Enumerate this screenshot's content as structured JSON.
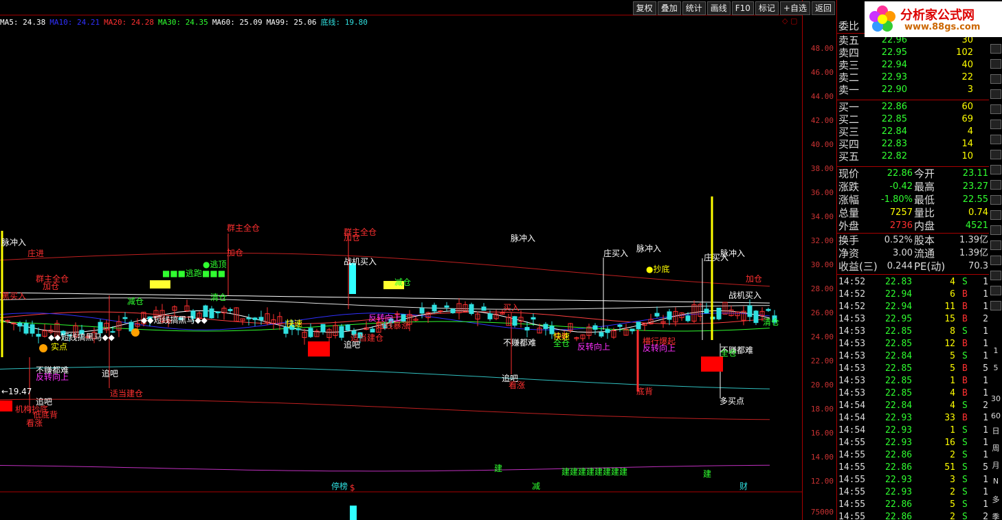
{
  "ma_legend": [
    {
      "text": "MA5: 24.38",
      "color": "#ffffff"
    },
    {
      "text": "MA10: 24.21",
      "color": "#3030ff"
    },
    {
      "text": "MA20: 24.28",
      "color": "#ff3030"
    },
    {
      "text": "MA30: 24.35",
      "color": "#30ff30"
    },
    {
      "text": "MA60: 25.09",
      "color": "#ffffff"
    },
    {
      "text": "MA99: 25.06",
      "color": "#ffffff"
    },
    {
      "text": "底线: 19.80",
      "color": "#30e0e0"
    }
  ],
  "toolbar": [
    "复权",
    "叠加",
    "统计",
    "画线",
    "F10",
    "标记",
    "+自选",
    "返回"
  ],
  "price_ticks": [
    "48.00",
    "46.00",
    "44.00",
    "42.00",
    "40.00",
    "38.00",
    "36.00",
    "34.00",
    "32.00",
    "30.00",
    "28.00",
    "26.00",
    "24.00",
    "22.00",
    "20.00",
    "18.00",
    "16.00",
    "14.00",
    "12.00"
  ],
  "volume_tick": "75000",
  "low_marker": "←19.47",
  "logo": {
    "title": "分析家公式网",
    "url": "www.88gs.com"
  },
  "order_book": {
    "header": "委比",
    "sells": [
      {
        "label": "卖五",
        "price": "22.96",
        "vol": "30"
      },
      {
        "label": "卖四",
        "price": "22.95",
        "vol": "102"
      },
      {
        "label": "卖三",
        "price": "22.94",
        "vol": "40"
      },
      {
        "label": "卖二",
        "price": "22.93",
        "vol": "22"
      },
      {
        "label": "卖一",
        "price": "22.90",
        "vol": "3"
      }
    ],
    "buys": [
      {
        "label": "买一",
        "price": "22.86",
        "vol": "60"
      },
      {
        "label": "买二",
        "price": "22.85",
        "vol": "69"
      },
      {
        "label": "买三",
        "price": "22.84",
        "vol": "4"
      },
      {
        "label": "买四",
        "price": "22.83",
        "vol": "14"
      },
      {
        "label": "买五",
        "price": "22.82",
        "vol": "10"
      }
    ]
  },
  "quote": [
    {
      "l1": "现价",
      "v1": "22.86",
      "l2": "今开",
      "v2": "23.11",
      "c1": "#30ff30",
      "c2": "#30ff30"
    },
    {
      "l1": "涨跌",
      "v1": "-0.42",
      "l2": "最高",
      "v2": "23.27",
      "c1": "#30ff30",
      "c2": "#30ff30"
    },
    {
      "l1": "涨幅",
      "v1": "-1.80%",
      "l2": "最低",
      "v2": "22.55",
      "c1": "#30ff30",
      "c2": "#30ff30"
    },
    {
      "l1": "总量",
      "v1": "7257",
      "l2": "量比",
      "v2": "0.74",
      "c1": "#ffff00",
      "c2": "#ffff00"
    },
    {
      "l1": "外盘",
      "v1": "2736",
      "l2": "内盘",
      "v2": "4521",
      "c1": "#ff3030",
      "c2": "#30ff30"
    }
  ],
  "fundamentals": [
    {
      "l1": "换手",
      "v1": "0.52%",
      "l2": "股本",
      "v2": "1.39亿"
    },
    {
      "l1": "净资",
      "v1": "3.00",
      "l2": "流通",
      "v2": "1.39亿"
    },
    {
      "l1": "收益(三)",
      "v1": "0.244",
      "l2": "PE(动)",
      "v2": "70.3"
    }
  ],
  "ticks": [
    {
      "t": "14:52",
      "p": "22.83",
      "v": "4",
      "s": "S",
      "n": "1"
    },
    {
      "t": "14:52",
      "p": "22.94",
      "v": "6",
      "s": "B",
      "n": "1"
    },
    {
      "t": "14:52",
      "p": "22.94",
      "v": "11",
      "s": "B",
      "n": "1"
    },
    {
      "t": "14:53",
      "p": "22.95",
      "v": "15",
      "s": "B",
      "n": "2"
    },
    {
      "t": "14:53",
      "p": "22.85",
      "v": "8",
      "s": "S",
      "n": "1"
    },
    {
      "t": "14:53",
      "p": "22.85",
      "v": "12",
      "s": "B",
      "n": "1"
    },
    {
      "t": "14:53",
      "p": "22.84",
      "v": "5",
      "s": "S",
      "n": "1"
    },
    {
      "t": "14:53",
      "p": "22.85",
      "v": "5",
      "s": "B",
      "n": "5"
    },
    {
      "t": "14:53",
      "p": "22.85",
      "v": "1",
      "s": "B",
      "n": "1"
    },
    {
      "t": "14:53",
      "p": "22.85",
      "v": "4",
      "s": "B",
      "n": "1"
    },
    {
      "t": "14:54",
      "p": "22.84",
      "v": "4",
      "s": "S",
      "n": "2"
    },
    {
      "t": "14:54",
      "p": "22.93",
      "v": "33",
      "s": "B",
      "n": "1"
    },
    {
      "t": "14:54",
      "p": "22.93",
      "v": "1",
      "s": "S",
      "n": "1"
    },
    {
      "t": "14:55",
      "p": "22.93",
      "v": "16",
      "s": "S",
      "n": "1"
    },
    {
      "t": "14:55",
      "p": "22.86",
      "v": "2",
      "s": "S",
      "n": "1"
    },
    {
      "t": "14:55",
      "p": "22.86",
      "v": "51",
      "s": "S",
      "n": "5"
    },
    {
      "t": "14:55",
      "p": "22.93",
      "v": "3",
      "s": "S",
      "n": "1"
    },
    {
      "t": "14:55",
      "p": "22.93",
      "v": "2",
      "s": "S",
      "n": "1"
    },
    {
      "t": "14:55",
      "p": "22.86",
      "v": "5",
      "s": "S",
      "n": "1"
    },
    {
      "t": "14:55",
      "p": "22.86",
      "v": "2",
      "s": "S",
      "n": "2"
    }
  ],
  "side_items": [
    "1",
    "5",
    "30",
    "60",
    "日",
    "周",
    "月",
    "N",
    "多",
    "季"
  ],
  "chart_labels": [
    {
      "text": "脉冲入",
      "color": "#ffffff"
    },
    {
      "text": "庄进",
      "color": "#ff3030"
    },
    {
      "text": "群主全仓",
      "color": "#ff3030"
    },
    {
      "text": "加仓",
      "color": "#ff3030"
    },
    {
      "text": "黑买入",
      "color": "#ff3030"
    },
    {
      "text": "群主全仓",
      "color": "#ff3030"
    },
    {
      "text": "加仓",
      "color": "#ff3030"
    },
    {
      "text": "群主全仓",
      "color": "#ff3030"
    },
    {
      "text": "加仓",
      "color": "#ff3030"
    },
    {
      "text": "脉冲入",
      "color": "#ffffff"
    },
    {
      "text": "庄买入",
      "color": "#ffffff"
    },
    {
      "text": "脉冲入",
      "color": "#ffffff"
    },
    {
      "text": "庄买入",
      "color": "#ffffff"
    },
    {
      "text": "脉冲入",
      "color": "#ffffff"
    },
    {
      "text": "战机买入",
      "color": "#ffffff"
    },
    {
      "text": "●逃顶",
      "color": "#30ff30"
    },
    {
      "text": "■■■逃跑■■■",
      "color": "#30ff30"
    },
    {
      "text": "减仓",
      "color": "#30ff30"
    },
    {
      "text": "清仓",
      "color": "#30ff30"
    },
    {
      "text": "减仓",
      "color": "#30ff30"
    },
    {
      "text": "●抄底",
      "color": "#ffff00"
    },
    {
      "text": "加仓",
      "color": "#ff3030"
    },
    {
      "text": "战机买入",
      "color": "#ffffff"
    },
    {
      "text": "清仓",
      "color": "#30ff30"
    },
    {
      "text": "◆◆短线搞黑马◆◆",
      "color": "#ffffff"
    },
    {
      "text": "◆◆短线搞黑马◆◆",
      "color": "#ffffff"
    },
    {
      "text": "快速",
      "color": "#ffff00"
    },
    {
      "text": "反转向上",
      "color": "#ff30ff"
    },
    {
      "text": "短线暴涨",
      "color": "#ff3030"
    },
    {
      "text": "追吧",
      "color": "#ffffff"
    },
    {
      "text": "适当建仓",
      "color": "#ff3030"
    },
    {
      "text": "买入",
      "color": "#ff3030"
    },
    {
      "text": "不赚都难",
      "color": "#ffffff"
    },
    {
      "text": "快速",
      "color": "#ffff00"
    },
    {
      "text": "全仓",
      "color": "#30ff30"
    },
    {
      "text": "反转向上",
      "color": "#ff30ff"
    },
    {
      "text": "横行爆起",
      "color": "#ff3030"
    },
    {
      "text": "反转向上",
      "color": "#ff30ff"
    },
    {
      "text": "不赚都难",
      "color": "#ffffff"
    },
    {
      "text": "全仓",
      "color": "#30ff30"
    },
    {
      "text": "实点",
      "color": "#ffff00"
    },
    {
      "text": "不赚都难",
      "color": "#ffffff"
    },
    {
      "text": "反转向上",
      "color": "#ff30ff"
    },
    {
      "text": "追吧",
      "color": "#ffffff"
    },
    {
      "text": "追吧",
      "color": "#ffffff"
    },
    {
      "text": "适当建仓",
      "color": "#ff3030"
    },
    {
      "text": "追吧",
      "color": "#ffffff"
    },
    {
      "text": "看涨",
      "color": "#ff3030"
    },
    {
      "text": "底背",
      "color": "#ff3030"
    },
    {
      "text": "多买点",
      "color": "#ffffff"
    },
    {
      "text": "机构抄底",
      "color": "#ff3030"
    },
    {
      "text": "低底背",
      "color": "#ff3030"
    },
    {
      "text": "看涨",
      "color": "#ff3030"
    },
    {
      "text": "建",
      "color": "#30ff30"
    },
    {
      "text": "建建建建建建建建",
      "color": "#30ff30"
    },
    {
      "text": "建",
      "color": "#30ff30"
    },
    {
      "text": "停榜",
      "color": "#30e0e0"
    },
    {
      "text": "$",
      "color": "#ff3030"
    },
    {
      "text": "减",
      "color": "#30ff30"
    },
    {
      "text": "财",
      "color": "#30e0e0"
    }
  ]
}
